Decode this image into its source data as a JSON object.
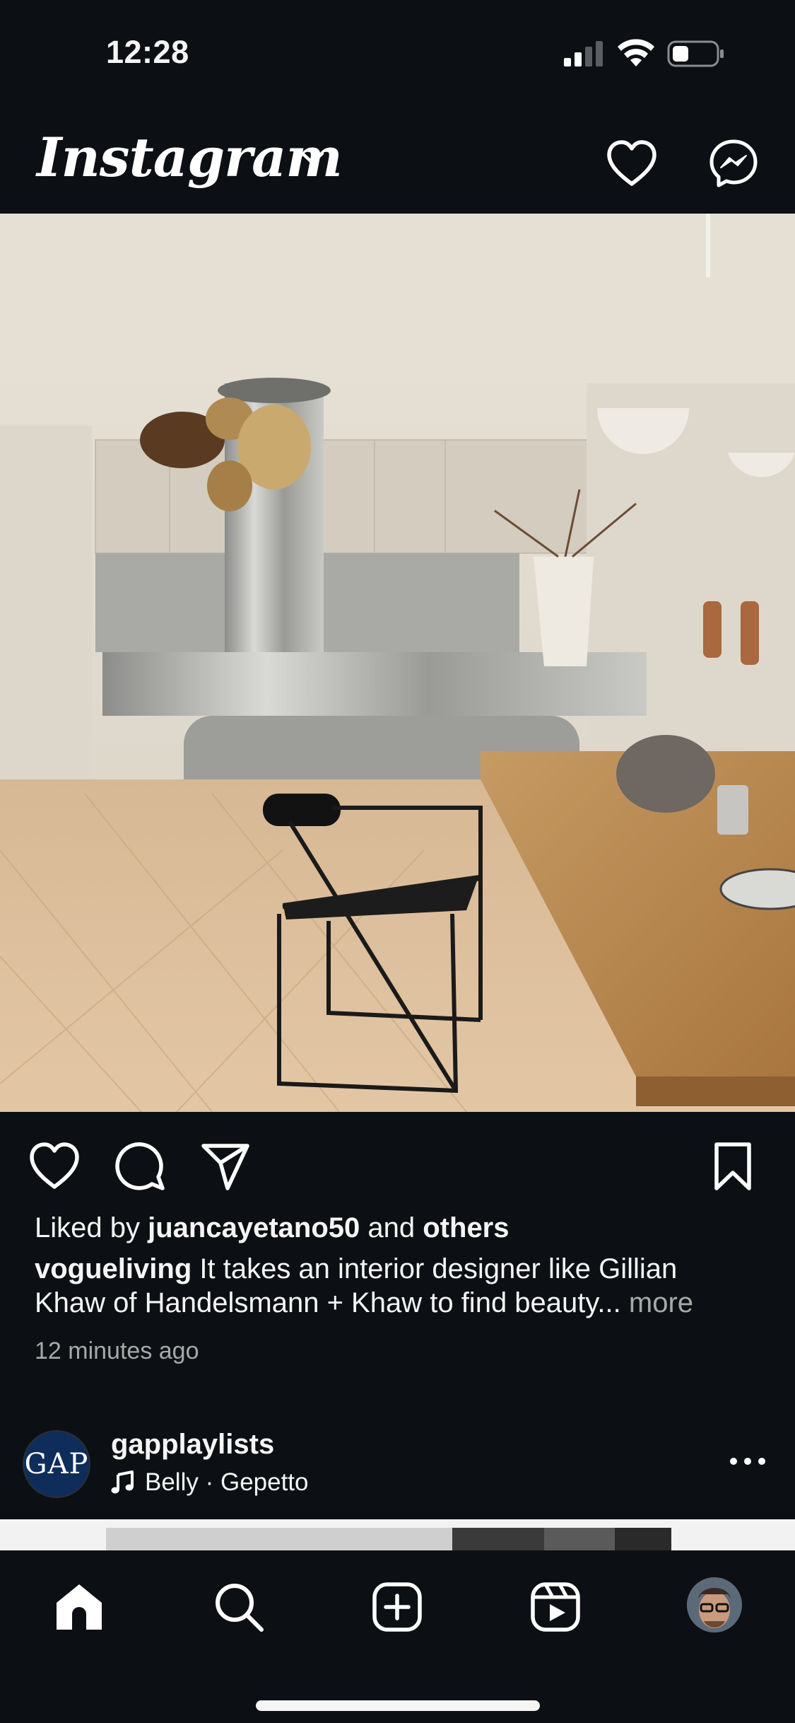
{
  "status_bar": {
    "time": "12:28",
    "icons": [
      "cellular-signal-icon",
      "wifi-icon",
      "battery-icon"
    ]
  },
  "app_bar": {
    "logo": "Instagram",
    "icons": [
      "chevron-down-icon",
      "heart-icon",
      "messenger-icon"
    ]
  },
  "post": {
    "image_alt": "Modern kitchen with stainless steel island, black chair and wooden dining table",
    "actions": [
      "like-icon",
      "comment-icon",
      "share-icon",
      "bookmark-icon"
    ],
    "liked_prefix": "Liked by",
    "liked_user": "juancayetano50",
    "liked_and": "and",
    "liked_others": "others",
    "author": "vogueliving",
    "caption_line1": "It takes an interior designer like Gillian",
    "caption_line2": "Khaw of Handelsmann + Khaw to find beauty...",
    "more": "more",
    "time_ago": "12 minutes ago"
  },
  "next_post": {
    "avatar_text": "GAP",
    "username": "gapplaylists",
    "audio": "Belly · Gepetto"
  },
  "bottom_nav": {
    "items": [
      "home-icon",
      "search-icon",
      "create-icon",
      "reels-icon",
      "profile-avatar"
    ]
  },
  "colors": {
    "background": "#0c1014",
    "text": "#f5f5f5",
    "secondary_text": "#a8a8a8",
    "gap_brand": "#0f2d5b"
  }
}
